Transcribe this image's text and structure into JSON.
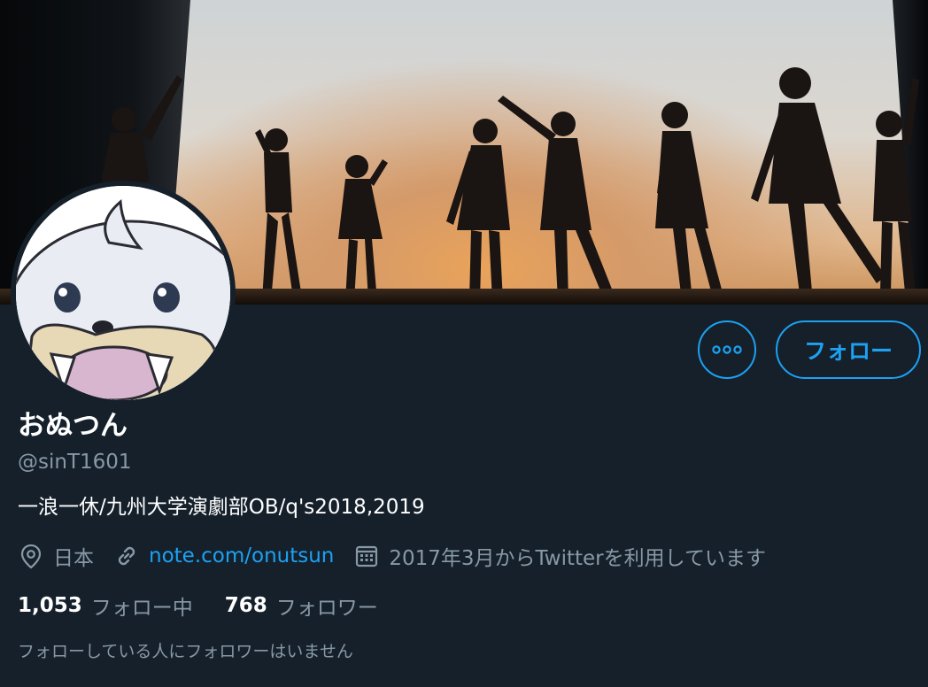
{
  "profile": {
    "display_name": "おぬつん",
    "handle": "@sinT1601",
    "bio": "一浪一休/九州大学演劇部OB/q's2018,2019",
    "location": "日本",
    "website": "note.com/onutsun",
    "joined": "2017年3月からTwitterを利用しています"
  },
  "actions": {
    "follow_label": "フォロー",
    "more_icon": "ellipsis-icon"
  },
  "stats": {
    "following_count": "1,053",
    "following_label": "フォロー中",
    "followers_count": "768",
    "followers_label": "フォロワー"
  },
  "mutual_note": "フォローしている人にフォロワーはいません",
  "icons": {
    "location": "location-pin-icon",
    "link": "link-icon",
    "calendar": "calendar-icon"
  },
  "colors": {
    "background": "#15202b",
    "accent": "#1da1f2",
    "secondary_text": "#8899a6",
    "primary_text": "#ffffff"
  }
}
